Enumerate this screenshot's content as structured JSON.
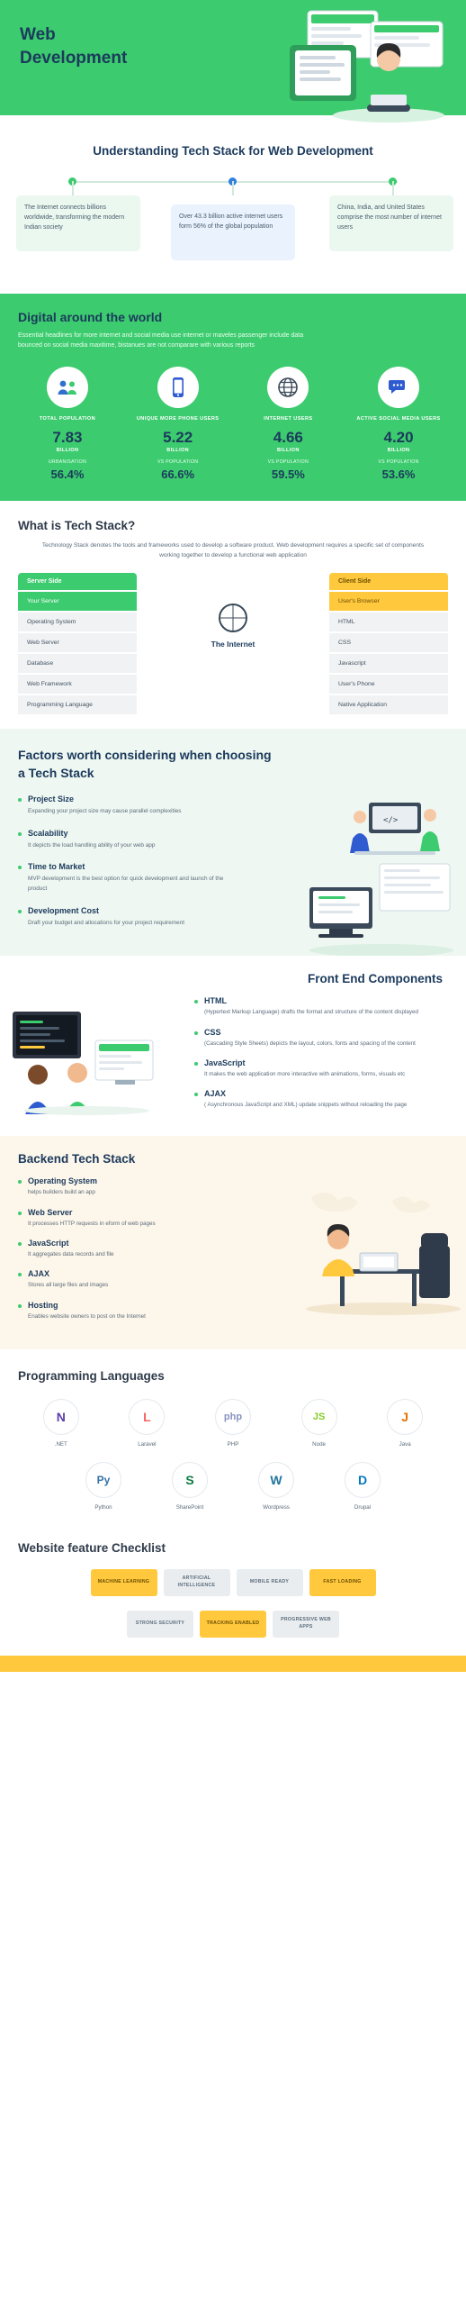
{
  "hero": {
    "title": "Web Development"
  },
  "understanding": {
    "title": "Understanding Tech Stack for Web Development",
    "cards": [
      {
        "text": "The Internet connects billions worldwide, transforming the modern Indian society"
      },
      {
        "text": "Over 43.3 billion active internet users form 56% of the global population"
      },
      {
        "text": "China, India, and United States comprise the most number of internet users"
      }
    ]
  },
  "digital": {
    "title": "Digital around the world",
    "subtitle": "Essential headlines for more internet and social media use internet or maveles passenger include data bounced on social media maxitime, bistanues are not comparare with various reports",
    "stats": [
      {
        "icon": "people-icon",
        "label": "TOTAL POPULATION",
        "value": "7.83",
        "unit": "BILLION",
        "sublabel": "URBANISATION",
        "pct": "56.4%"
      },
      {
        "icon": "phone-icon",
        "label": "UNIQUE MORE PHONE USERS",
        "value": "5.22",
        "unit": "BILLION",
        "sublabel": "VS POPULATION",
        "pct": "66.6%"
      },
      {
        "icon": "globe-icon",
        "label": "INTERNET USERS",
        "value": "4.66",
        "unit": "BILLION",
        "sublabel": "VS POPULATION",
        "pct": "59.5%"
      },
      {
        "icon": "chat-icon",
        "label": "ACTIVE SOCIAL MEDIA USERS",
        "value": "4.20",
        "unit": "BILLION",
        "sublabel": "VS POPULATION",
        "pct": "53.6%"
      }
    ]
  },
  "what_is": {
    "title": "What is Tech Stack?",
    "description": "Technology Stack denotes the tools and frameworks used to develop a software product. Web development requires a specific set of components working together to develop a functional web application",
    "left_header": "Server Side",
    "right_header": "Client Side",
    "left_rows": [
      "Your Server",
      "Operating System",
      "Web Server",
      "Database",
      "Web Framework",
      "Programming Language"
    ],
    "right_rows": [
      "User's Browser",
      "HTML",
      "CSS",
      "Javascript",
      "User's Phone",
      "Native Application"
    ],
    "middle_label": "The Internet",
    "middle_icon": "globe-icon"
  },
  "factors": {
    "title": "Factors worth considering when choosing a Tech Stack",
    "items": [
      {
        "name": "Project Size",
        "desc": "Expanding your project size may cause parallel complexities"
      },
      {
        "name": "Scalability",
        "desc": "It depicts the load handling ability of your web app"
      },
      {
        "name": "Time to Market",
        "desc": "MVP development is the best option for quick development and launch of the product"
      },
      {
        "name": "Development Cost",
        "desc": "Draft your budget and allocations for your project requirement"
      }
    ]
  },
  "frontend": {
    "title": "Front End Components",
    "items": [
      {
        "name": "HTML",
        "desc": "(Hypertext Markup Language) drafts the format and structure of the content displayed"
      },
      {
        "name": "CSS",
        "desc": "(Cascading Style Sheets) depicts the layout, colors, fonts and spacing of the content"
      },
      {
        "name": "JavaScript",
        "desc": "It makes the web application more interactive with animations, forms, visuals etc"
      },
      {
        "name": "AJAX",
        "desc": "( Asynchronous JavaScript and XML) update snippets without reloading the page"
      }
    ]
  },
  "backend": {
    "title": "Backend Tech Stack",
    "items": [
      {
        "name": "Operating System",
        "desc": "helps builders build an app"
      },
      {
        "name": "Web Server",
        "desc": "It processes HTTP requests in eform of web pages"
      },
      {
        "name": "JavaScript",
        "desc": "It aggregates data records and file"
      },
      {
        "name": "AJAX",
        "desc": "Stores all large files and images"
      },
      {
        "name": "Hosting",
        "desc": "Enables website owners to post on the Internet"
      }
    ]
  },
  "languages": {
    "title": "Programming Languages",
    "row1": [
      {
        "name": ".NET",
        "glyph": "N",
        "color": "#5b3ea8"
      },
      {
        "name": "Laravel",
        "glyph": "L",
        "color": "#f4645f"
      },
      {
        "name": "PHP",
        "glyph": "php",
        "color": "#8892bf"
      },
      {
        "name": "Node",
        "glyph": "JS",
        "color": "#83cd29"
      },
      {
        "name": "Java",
        "glyph": "J",
        "color": "#e76f00"
      }
    ],
    "row2": [
      {
        "name": "Python",
        "glyph": "Py",
        "color": "#3572a5"
      },
      {
        "name": "SharePoint",
        "glyph": "S",
        "color": "#0a7c42"
      },
      {
        "name": "Wordpress",
        "glyph": "W",
        "color": "#21759b"
      },
      {
        "name": "Drupal",
        "glyph": "D",
        "color": "#0678be"
      }
    ]
  },
  "checklist": {
    "title": "Website feature Checklist",
    "row1": [
      {
        "label": "MACHINE LEARNING",
        "style": "y"
      },
      {
        "label": "ARTIFICIAL INTELLIGENCE",
        "style": "gr"
      },
      {
        "label": "MOBILE READY",
        "style": "gr"
      },
      {
        "label": "FAST LOADING",
        "style": "y"
      }
    ],
    "row2": [
      {
        "label": "STRONG SECURITY",
        "style": "gr"
      },
      {
        "label": "TRACKING ENABLED",
        "style": "y"
      },
      {
        "label": "PROGRESSIVE WEB APPS",
        "style": "gr"
      }
    ]
  }
}
